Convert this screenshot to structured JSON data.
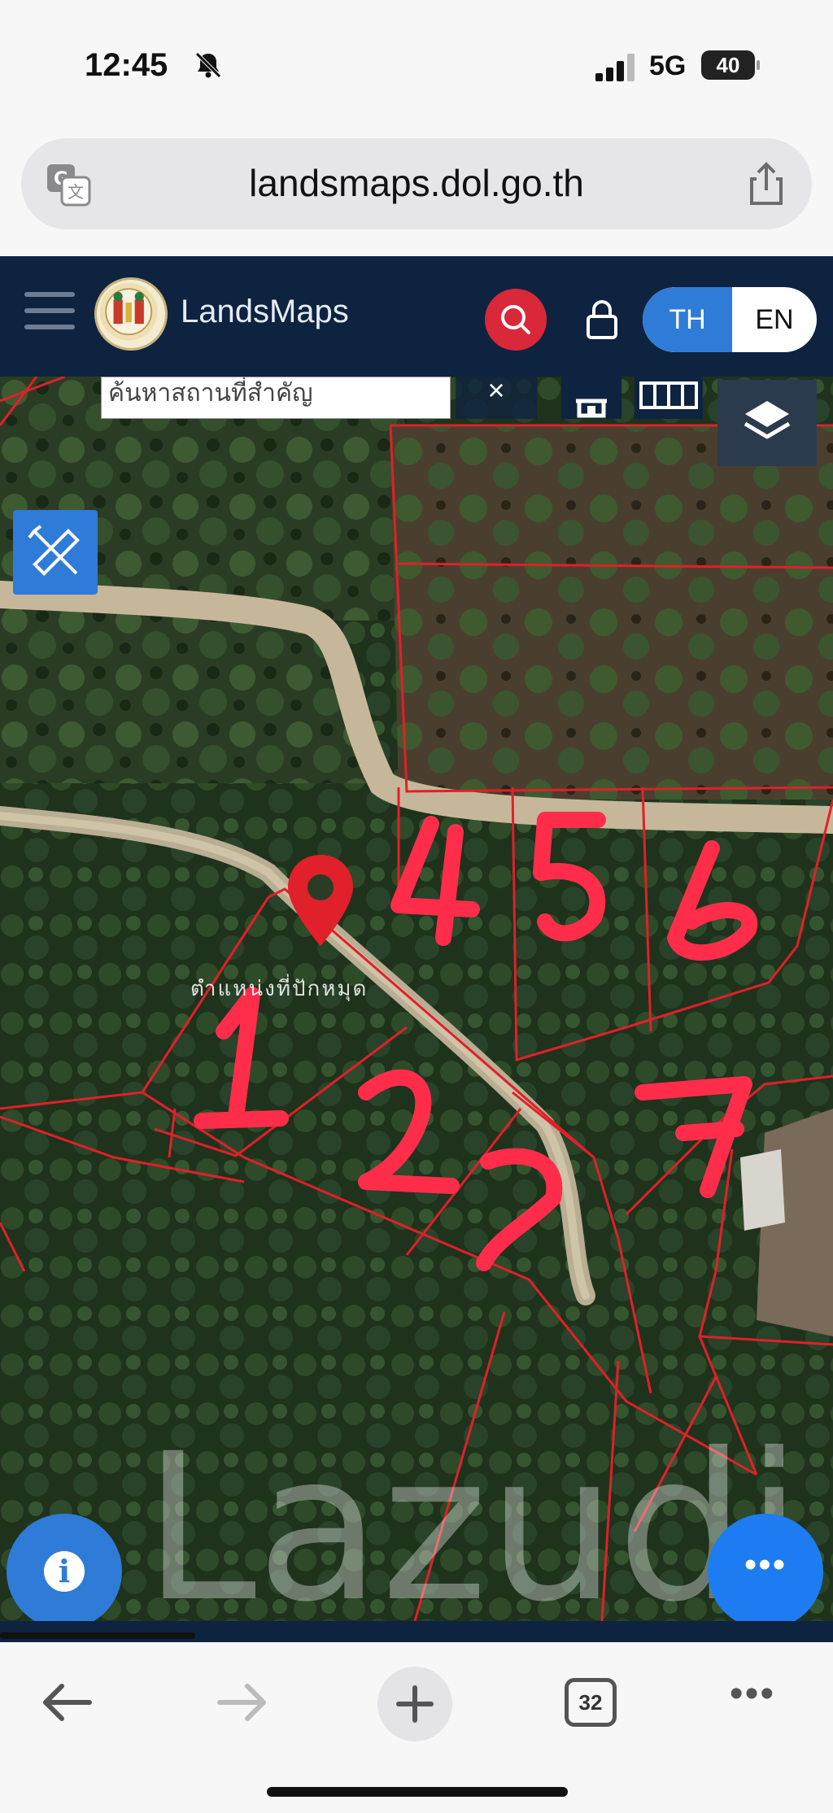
{
  "status_bar": {
    "time": "12:45",
    "network": "5G",
    "battery": "40",
    "icons": [
      "bell-slash-icon",
      "signal-icon"
    ]
  },
  "browser": {
    "url": "landsmaps.dol.go.th",
    "icons": [
      "translate-icon",
      "share-icon"
    ]
  },
  "app_header": {
    "brand": "LandsMaps",
    "search_icon": "search-icon",
    "lock_icon": "lock-icon",
    "language": {
      "th": "TH",
      "en": "EN",
      "selected": "TH"
    },
    "colors": {
      "header_bg": "#0e2340",
      "search_btn": "#d9283a",
      "lang_active": "#2f7bd8"
    }
  },
  "map": {
    "search_placeholder": "ค้นหาสถานที่สำคัญ",
    "clear_label": "×",
    "pin_label": "ตำแหน่งที่ปักหมุด",
    "plot_numbers": [
      "1",
      "2",
      "3",
      "4",
      "5",
      "6",
      "7"
    ],
    "watermark": "Lazudi",
    "buttons": [
      "layers-icon",
      "ruler-pencil-icon",
      "info-icon",
      "more-icon"
    ],
    "colors": {
      "parcel_lines": "#e0202a",
      "annotation": "#ff2d4a"
    }
  },
  "browser_toolbar": {
    "tab_count": "32",
    "icons": [
      "back-arrow-icon",
      "forward-arrow-icon",
      "new-tab-plus-icon",
      "tabs-icon",
      "more-dots-icon"
    ]
  }
}
